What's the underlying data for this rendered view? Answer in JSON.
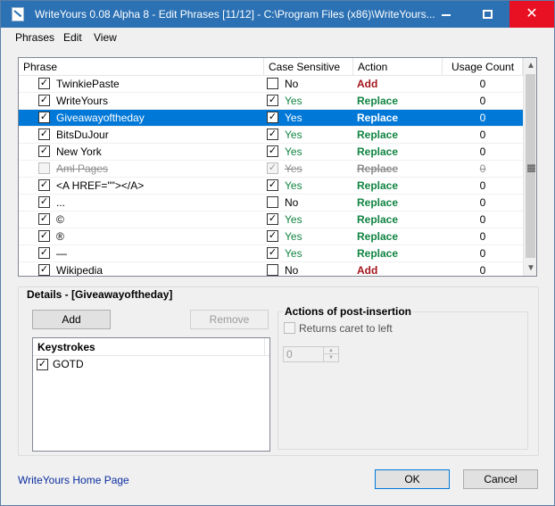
{
  "window": {
    "title": "WriteYours 0.08 Alpha 8 - Edit Phrases [11/12] - C:\\Program Files (x86)\\WriteYours...",
    "accent_color": "#2b71b4",
    "close_color": "#e81123"
  },
  "menu": {
    "items": [
      "Phrases",
      "Edit",
      "View"
    ]
  },
  "grid": {
    "columns": [
      "Phrase",
      "Case Sensitive",
      "Action",
      "Usage Count"
    ],
    "rows": [
      {
        "enabled": true,
        "phrase": "TwinkiePaste",
        "case_sensitive": false,
        "case_text": "No",
        "action": "Add",
        "usage": "0"
      },
      {
        "enabled": true,
        "phrase": "WriteYours",
        "case_sensitive": true,
        "case_text": "Yes",
        "action": "Replace",
        "usage": "0"
      },
      {
        "enabled": true,
        "phrase": "Giveawayoftheday",
        "case_sensitive": true,
        "case_text": "Yes",
        "action": "Replace",
        "usage": "0",
        "selected": true
      },
      {
        "enabled": true,
        "phrase": "BitsDuJour",
        "case_sensitive": true,
        "case_text": "Yes",
        "action": "Replace",
        "usage": "0"
      },
      {
        "enabled": true,
        "phrase": "New York",
        "case_sensitive": true,
        "case_text": "Yes",
        "action": "Replace",
        "usage": "0"
      },
      {
        "enabled": false,
        "phrase": "Aml Pages",
        "case_sensitive": true,
        "case_text": "Yes",
        "action": "Replace",
        "usage": "0"
      },
      {
        "enabled": true,
        "phrase": "<A HREF=\"\"></A>",
        "case_sensitive": true,
        "case_text": "Yes",
        "action": "Replace",
        "usage": "0"
      },
      {
        "enabled": true,
        "phrase": "...",
        "case_sensitive": false,
        "case_text": "No",
        "action": "Replace",
        "usage": "0"
      },
      {
        "enabled": true,
        "phrase": "©",
        "case_sensitive": true,
        "case_text": "Yes",
        "action": "Replace",
        "usage": "0"
      },
      {
        "enabled": true,
        "phrase": "®",
        "case_sensitive": true,
        "case_text": "Yes",
        "action": "Replace",
        "usage": "0"
      },
      {
        "enabled": true,
        "phrase": "—",
        "case_sensitive": true,
        "case_text": "Yes",
        "action": "Replace",
        "usage": "0"
      },
      {
        "enabled": true,
        "phrase": "Wikipedia",
        "case_sensitive": false,
        "case_text": "No",
        "action": "Add",
        "usage": "0"
      }
    ],
    "colors": {
      "replace": "#118442",
      "add": "#a3161c",
      "selection": "#0078d7"
    }
  },
  "details": {
    "title": "Details - [Giveawayoftheday]",
    "add_label": "Add",
    "remove_label": "Remove",
    "keystrokes_header": "Keystrokes",
    "keystrokes": [
      {
        "checked": true,
        "text": "GOTD"
      }
    ]
  },
  "post_insertion": {
    "title": "Actions of post-insertion",
    "returns_caret_label": "Returns caret to left",
    "returns_caret_checked": false,
    "caret_value": "0"
  },
  "footer": {
    "home_link": "WriteYours Home Page",
    "ok_label": "OK",
    "cancel_label": "Cancel"
  }
}
